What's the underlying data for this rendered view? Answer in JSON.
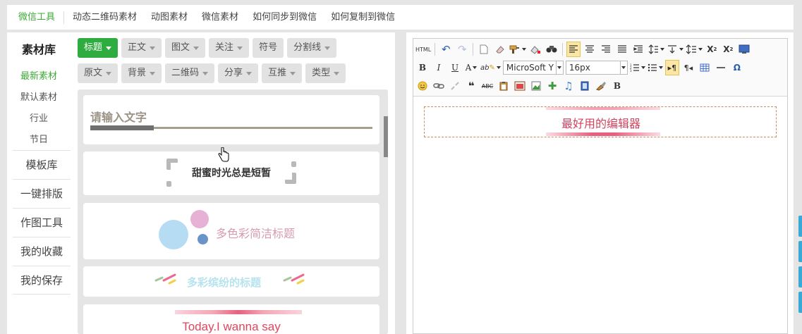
{
  "topnav": {
    "items": [
      "微信工具",
      "动态二维码素材",
      "动图素材",
      "微信素材",
      "如何同步到微信",
      "如何复制到微信"
    ]
  },
  "sidebar": {
    "title": "素材库",
    "subs": [
      "最新素材",
      "默认素材",
      "行业",
      "节日"
    ],
    "mains": [
      "模板库",
      "一键排版",
      "作图工具",
      "我的收藏",
      "我的保存"
    ]
  },
  "filters": {
    "row1": [
      "标题",
      "正文",
      "图文",
      "关注",
      "符号",
      "分割线"
    ],
    "row2": [
      "原文",
      "背景",
      "二维码",
      "分享",
      "互推",
      "类型"
    ]
  },
  "cards": {
    "c1": "请输入文字",
    "c2": "甜蜜时光总是短暂",
    "c3": "多色彩简洁标题",
    "c4": "多彩缤纷的标题",
    "c5": "Today.I wanna say"
  },
  "editor": {
    "html_label": "HTML",
    "font_family": "MicroSoft Y",
    "font_size": "16px",
    "content_title": "最好用的编辑器"
  },
  "colors": {
    "accent_green": "#2fac3f",
    "pink_title": "#d0435f"
  }
}
